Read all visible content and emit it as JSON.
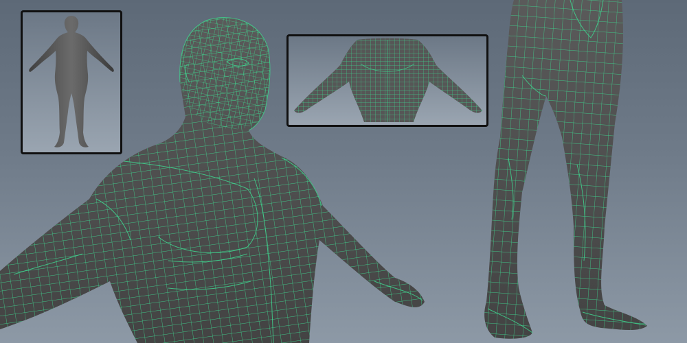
{
  "scene": {
    "colors": {
      "background_top": "#5d6977",
      "background_bottom": "#8d99a6",
      "mesh_skin": "#4f4f4f",
      "wireframe": "#3fd38e",
      "panel_border": "#101010"
    },
    "views": [
      {
        "name": "full-body-shaded-thumbnail",
        "style": "shaded"
      },
      {
        "name": "upper-body-wireframe",
        "style": "wireframe"
      },
      {
        "name": "back-wireframe-thumbnail",
        "style": "wireframe"
      },
      {
        "name": "legs-wireframe",
        "style": "wireframe"
      }
    ]
  }
}
